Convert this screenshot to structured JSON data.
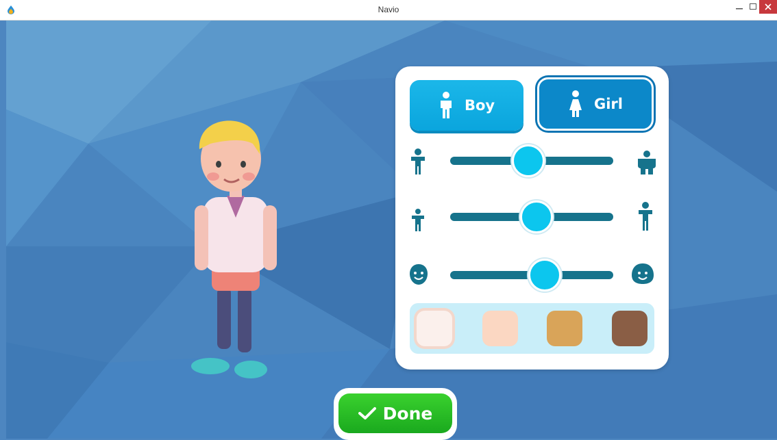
{
  "window": {
    "title": "Navio"
  },
  "gender": {
    "boy_label": "Boy",
    "girl_label": "Girl",
    "selected": "Girl"
  },
  "sliders": [
    {
      "name": "weight",
      "value": 0.48,
      "left_icon": "thin-person-icon",
      "right_icon": "heavy-person-icon"
    },
    {
      "name": "height",
      "value": 0.53,
      "left_icon": "short-person-icon",
      "right_icon": "tall-person-icon"
    },
    {
      "name": "face",
      "value": 0.58,
      "left_icon": "round-face-icon",
      "right_icon": "wide-face-icon"
    }
  ],
  "skin_tones": [
    {
      "color": "#fbf0ec",
      "selected": true
    },
    {
      "color": "#fbd7c2",
      "selected": false
    },
    {
      "color": "#d9a459",
      "selected": false
    },
    {
      "color": "#8a5e45",
      "selected": false
    }
  ],
  "done": {
    "label": "Done"
  },
  "colors": {
    "accent": "#0aa5dd",
    "track": "#16738c",
    "thumb": "#0cc6ee",
    "done": "#22b423",
    "background": "#4d86c0"
  }
}
